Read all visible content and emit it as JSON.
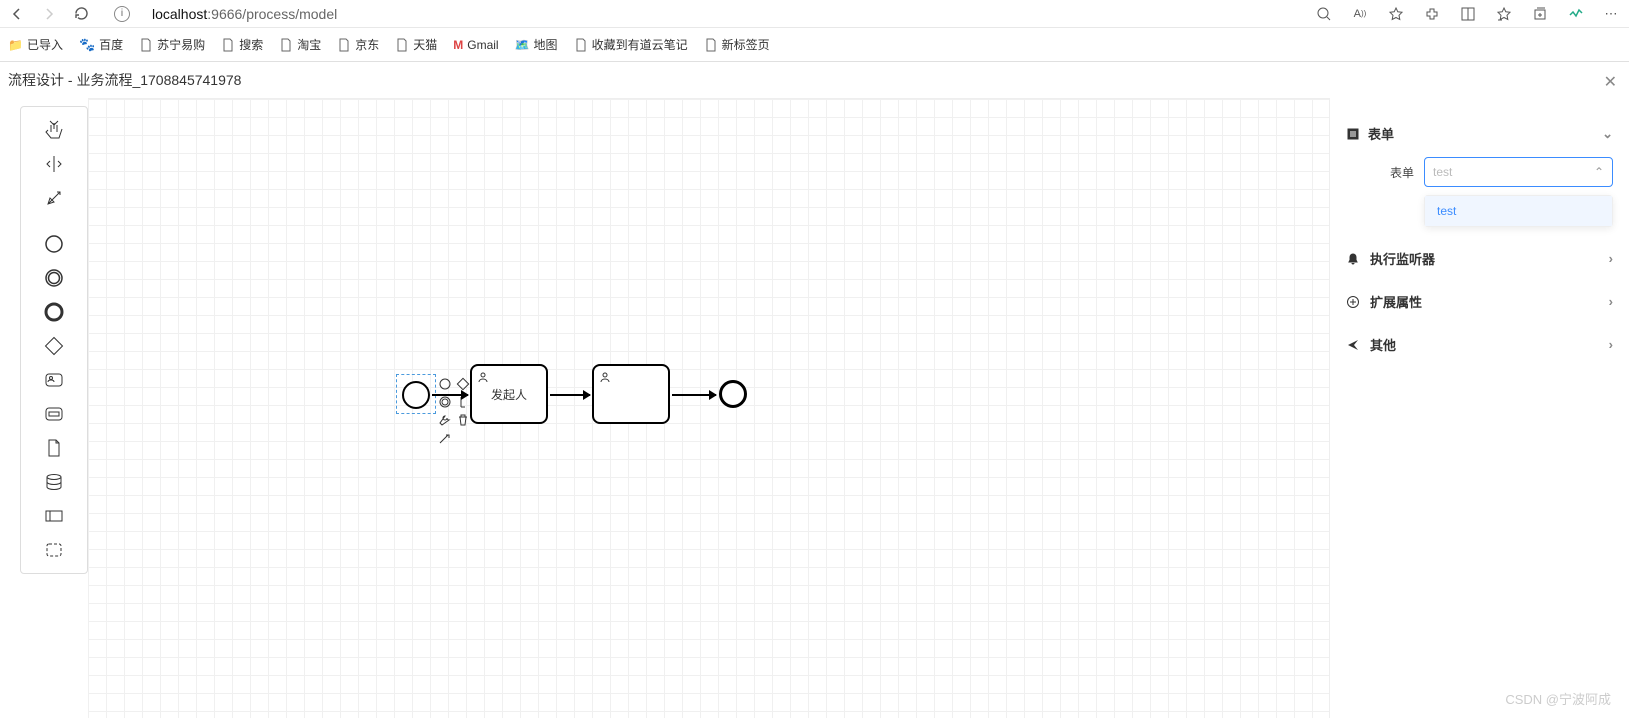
{
  "browser": {
    "url_host": "localhost",
    "url_rest": ":9666/process/model",
    "bookmarks": [
      {
        "label": "已导入",
        "icon": "folder"
      },
      {
        "label": "百度",
        "icon": "baidu"
      },
      {
        "label": "苏宁易购",
        "icon": "page"
      },
      {
        "label": "搜索",
        "icon": "page"
      },
      {
        "label": "淘宝",
        "icon": "page"
      },
      {
        "label": "京东",
        "icon": "page"
      },
      {
        "label": "天猫",
        "icon": "page"
      },
      {
        "label": "Gmail",
        "icon": "gmail"
      },
      {
        "label": "地图",
        "icon": "map"
      },
      {
        "label": "收藏到有道云笔记",
        "icon": "page"
      },
      {
        "label": "新标签页",
        "icon": "page"
      }
    ]
  },
  "title": "流程设计 - 业务流程_1708845741978",
  "canvas": {
    "start_label": "",
    "task1_label": "发起人",
    "task2_label": ""
  },
  "props": {
    "section_form_title": "表单",
    "form_label": "表单",
    "form_placeholder": "test",
    "dropdown_options": [
      "test"
    ],
    "section_listener": "执行监听器",
    "section_ext": "扩展属性",
    "section_other": "其他"
  },
  "watermark": "CSDN @宁波阿成"
}
